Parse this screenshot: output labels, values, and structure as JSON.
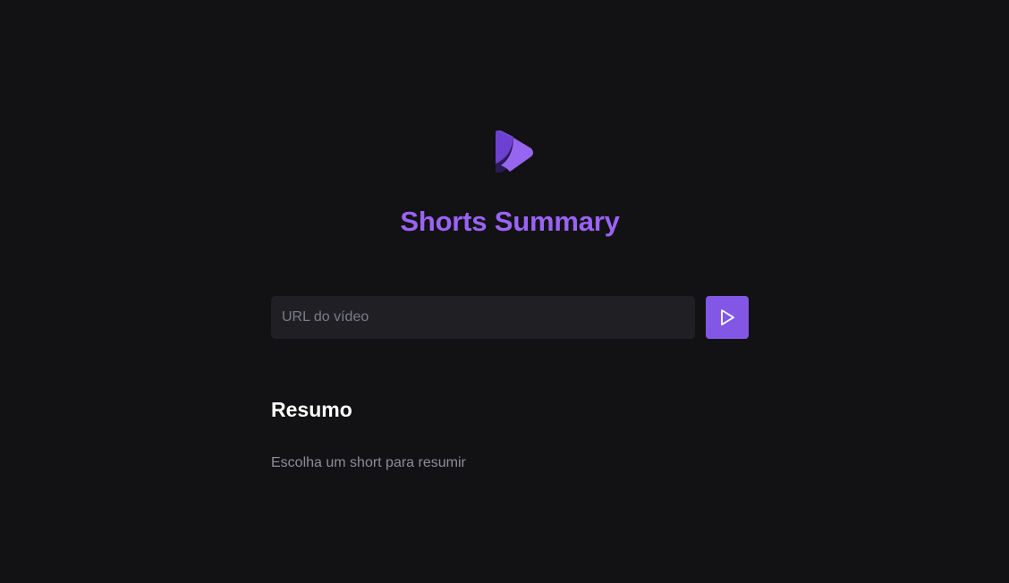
{
  "app": {
    "title": "Shorts Summary",
    "logo_icon": "play-logo-icon"
  },
  "form": {
    "url_placeholder": "URL do vídeo",
    "url_value": "",
    "submit_icon": "play-icon"
  },
  "summary": {
    "heading": "Resumo",
    "text": "Escolha um short para resumir"
  },
  "colors": {
    "background": "#121214",
    "accent": "#8257e5",
    "title": "#9a63f5",
    "input_background": "#202024",
    "muted_text": "#8d8d99"
  }
}
